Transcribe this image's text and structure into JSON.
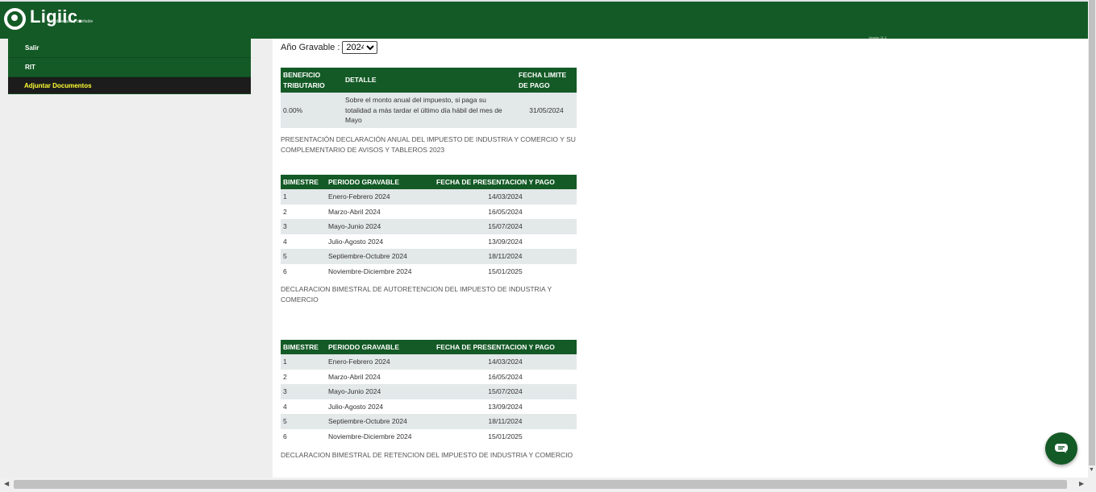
{
  "header": {
    "logo_text": "Ligiic.",
    "logo_tagline": "fácil, seguro y confiable",
    "version": "Versión 21.3",
    "brand_color": "#145a26"
  },
  "sidebar": {
    "items": [
      {
        "label": "Salir"
      },
      {
        "label": "RIT"
      },
      {
        "label": "Adjuntar Documentos"
      }
    ]
  },
  "filter": {
    "label": "Año Gravable :",
    "selected": "2024"
  },
  "benefit_table": {
    "headers": [
      "BENEFICIO TRIBUTARIO",
      "DETALLE",
      "FECHA LIMITE DE PAGO"
    ],
    "rows": [
      {
        "beneficio": "0.00%",
        "detalle": "Sobre el monto anual del impuesto, si paga su totalidad a más tardar el último día hábil del mes de Mayo",
        "fecha": "31/05/2024"
      }
    ],
    "note": "PRESENTACIÓN DECLARACIÓN ANUAL DEL IMPUESTO DE INDUSTRIA Y COMERCIO Y SU COMPLEMENTARIO DE AVISOS Y TABLEROS 2023"
  },
  "autoretencion_table": {
    "headers": [
      "BIMESTRE",
      "PERIODO GRAVABLE",
      "FECHA DE PRESENTACION Y PAGO"
    ],
    "rows": [
      {
        "bimestre": "1",
        "periodo": "Enero-Febrero 2024",
        "fecha": "14/03/2024"
      },
      {
        "bimestre": "2",
        "periodo": "Marzo-Abril 2024",
        "fecha": "16/05/2024"
      },
      {
        "bimestre": "3",
        "periodo": "Mayo-Junio 2024",
        "fecha": "15/07/2024"
      },
      {
        "bimestre": "4",
        "periodo": "Julio-Agosto 2024",
        "fecha": "13/09/2024"
      },
      {
        "bimestre": "5",
        "periodo": "Septiembre-Octubre 2024",
        "fecha": "18/11/2024"
      },
      {
        "bimestre": "6",
        "periodo": "Noviembre-Diciembre 2024",
        "fecha": "15/01/2025"
      }
    ],
    "note": "DECLARACION BIMESTRAL DE AUTORETENCION DEL IMPUESTO DE INDUSTRIA Y COMERCIO"
  },
  "retencion_table": {
    "headers": [
      "BIMESTRE",
      "PERIODO GRAVABLE",
      "FECHA DE PRESENTACION Y PAGO"
    ],
    "rows": [
      {
        "bimestre": "1",
        "periodo": "Enero-Febrero 2024",
        "fecha": "14/03/2024"
      },
      {
        "bimestre": "2",
        "periodo": "Marzo-Abril 2024",
        "fecha": "16/05/2024"
      },
      {
        "bimestre": "3",
        "periodo": "Mayo-Junio 2024",
        "fecha": "15/07/2024"
      },
      {
        "bimestre": "4",
        "periodo": "Julio-Agosto 2024",
        "fecha": "13/09/2024"
      },
      {
        "bimestre": "5",
        "periodo": "Septiembre-Octubre 2024",
        "fecha": "18/11/2024"
      },
      {
        "bimestre": "6",
        "periodo": "Noviembre-Diciembre 2024",
        "fecha": "15/01/2025"
      }
    ],
    "note": "DECLARACION BIMESTRAL DE RETENCION DEL IMPUESTO DE INDUSTRIA Y COMERCIO"
  },
  "chat": {
    "icon": "chat-icon"
  }
}
